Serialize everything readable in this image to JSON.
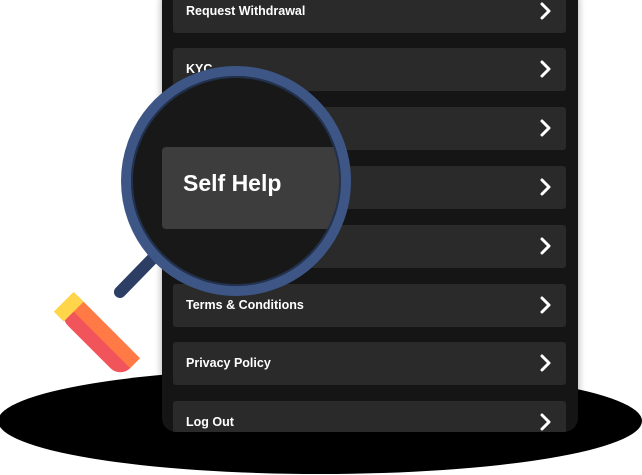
{
  "menu": {
    "items": [
      {
        "label": "Request Withdrawal"
      },
      {
        "label": "KYC"
      },
      {
        "label": ""
      },
      {
        "label": ""
      },
      {
        "label": ""
      },
      {
        "label": "Terms & Conditions"
      },
      {
        "label": "Privacy Policy"
      },
      {
        "label": "Log Out"
      }
    ]
  },
  "magnifier": {
    "focused_label": "Self Help"
  },
  "icons": {
    "row_chevron": "chevron-right-icon",
    "magnifying_glass": "magnifying-glass-icon"
  },
  "colors": {
    "panel": "#151515",
    "row": "#2a2a2a",
    "lens_ring": "#3d5685",
    "handle_orange": "#ff7a45",
    "handle_red": "#f2545b",
    "handle_yellow": "#ffd54a"
  }
}
